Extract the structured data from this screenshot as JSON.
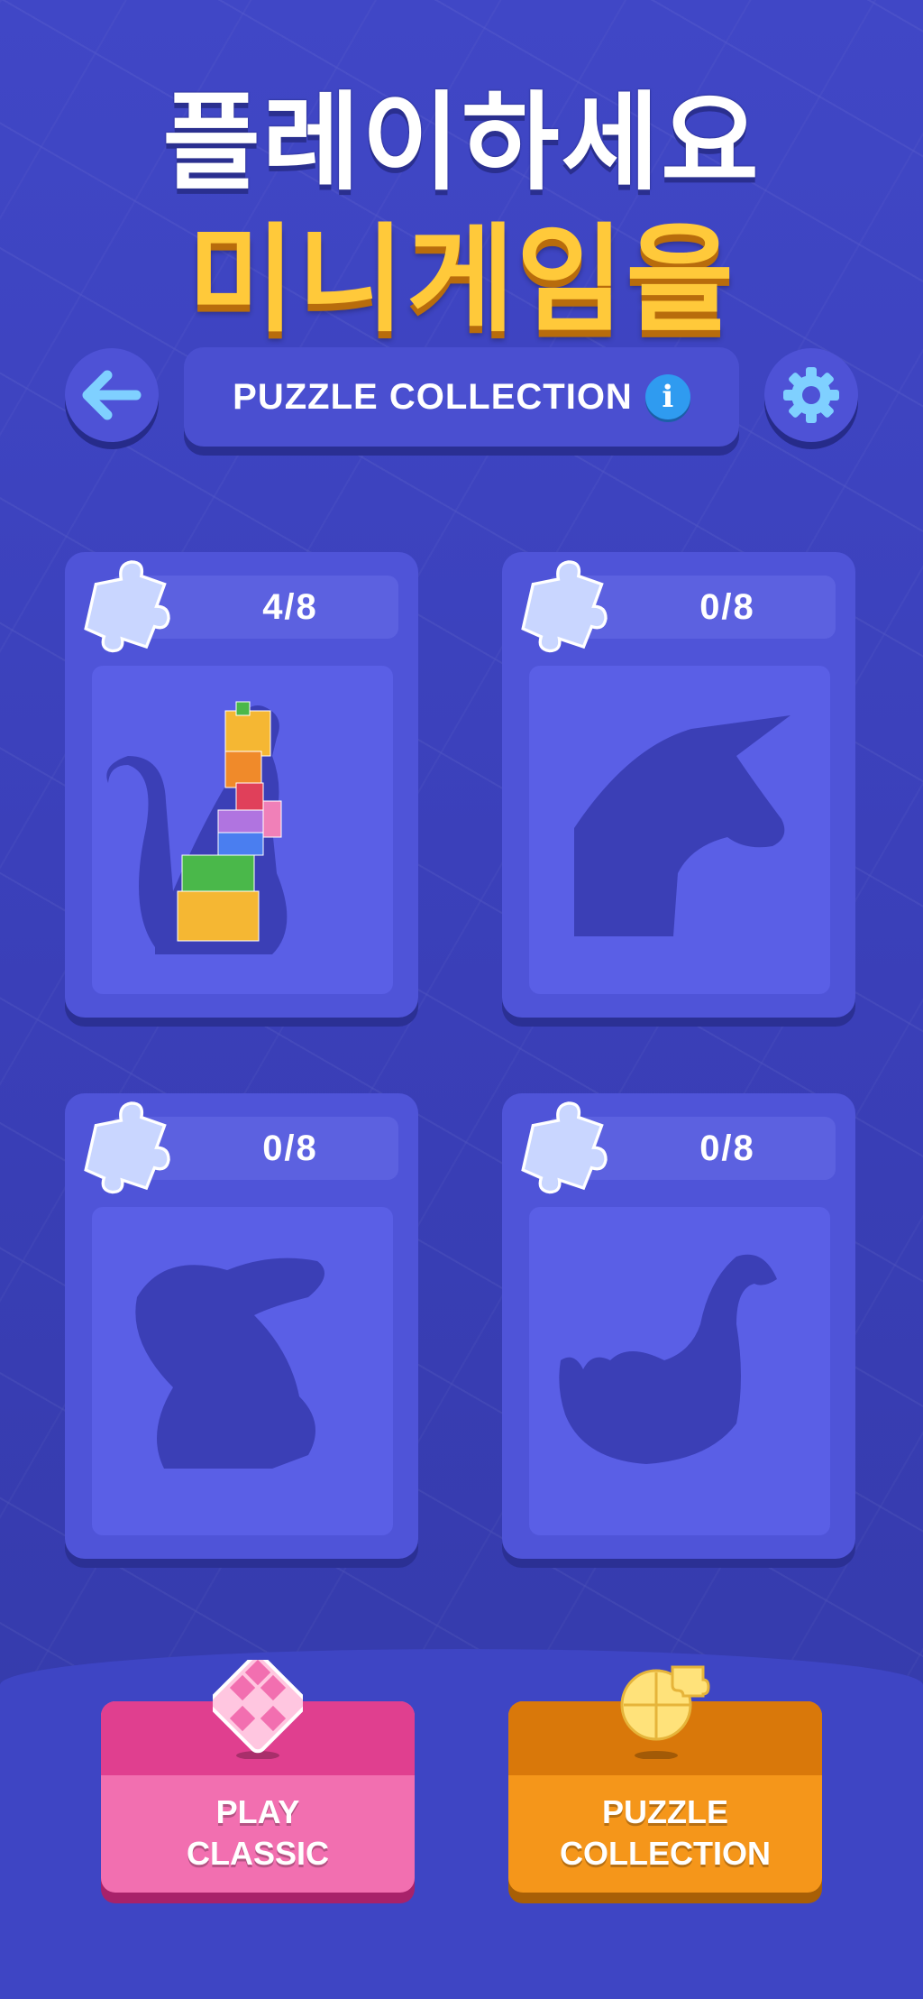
{
  "title": {
    "line1": "플레이하세요",
    "line2": "미니게임을"
  },
  "header": {
    "back_icon": "arrow-left-icon",
    "label": "PUZZLE COLLECTION",
    "info_icon": "info-icon",
    "info_glyph": "i",
    "settings_icon": "gear-icon"
  },
  "puzzles": [
    {
      "name": "cat",
      "progress": "4/8",
      "icon": "puzzle-piece-icon"
    },
    {
      "name": "unicorn",
      "progress": "0/8",
      "icon": "puzzle-piece-icon"
    },
    {
      "name": "rabbit",
      "progress": "0/8",
      "icon": "puzzle-piece-icon"
    },
    {
      "name": "swan",
      "progress": "0/8",
      "icon": "puzzle-piece-icon"
    }
  ],
  "bottom_nav": {
    "play_classic": {
      "line1": "PLAY",
      "line2": "CLASSIC",
      "icon": "block-grid-icon",
      "color": "#f26fb0"
    },
    "puzzle_collection": {
      "line1": "PUZZLE",
      "line2": "COLLECTION",
      "icon": "jigsaw-icon",
      "color": "#f5961a"
    }
  },
  "colors": {
    "background": "#3a3fb8",
    "title_yellow": "#ffc93a",
    "card": "#4f54d8",
    "silhouette": "#3b3fb6"
  }
}
